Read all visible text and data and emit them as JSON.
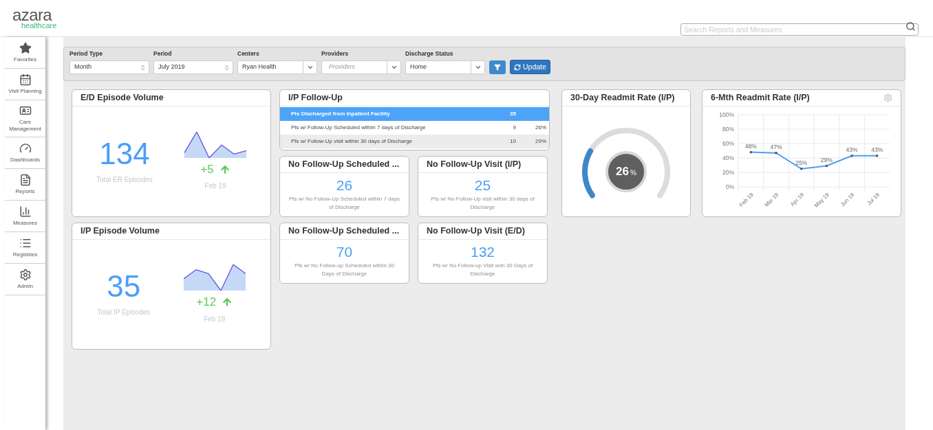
{
  "logo": {
    "name": "azara",
    "tagline": "healthcare"
  },
  "search": {
    "placeholder": "Search Reports and Measures"
  },
  "sidebar": {
    "items": [
      {
        "label": "Favorites",
        "kind": "star"
      },
      {
        "label": "Visit Planning",
        "kind": "calendar"
      },
      {
        "label": "Care Management",
        "kind": "card"
      },
      {
        "label": "Dashboards",
        "kind": "gauge"
      },
      {
        "label": "Reports",
        "kind": "report"
      },
      {
        "label": "Measures",
        "kind": "bars"
      },
      {
        "label": "Registries",
        "kind": "list"
      },
      {
        "label": "Admin",
        "kind": "gear"
      }
    ]
  },
  "filters": [
    {
      "label": "Period Type",
      "value": "Month",
      "kind": "select"
    },
    {
      "label": "Period",
      "value": "July 2019",
      "kind": "select"
    },
    {
      "label": "Centers",
      "value": "Ryan Health",
      "kind": "combo"
    },
    {
      "label": "Providers",
      "placeholder": "Providers",
      "kind": "combo"
    },
    {
      "label": "Discharge Status",
      "value": "Home",
      "kind": "combo"
    }
  ],
  "update_button": "Update",
  "ed_volume": {
    "title": "E/D Episode Volume",
    "value": "134",
    "caption": "Total ER Episodes",
    "change": "+5",
    "period": "Feb 19"
  },
  "ip_volume": {
    "title": "I/P Episode Volume",
    "value": "35",
    "caption": "Total IP Episodes",
    "change": "+12",
    "period": "Feb 19"
  },
  "ip_follow_up": {
    "title": "I/P Follow-Up",
    "rows": [
      {
        "label": "Pts Discharged from Inpatient Facility",
        "count": "35",
        "selected": true
      },
      {
        "label": "Pts w/ Follow-Up Scheduled within 7 days of Discharge",
        "count": "9",
        "percent": "26%",
        "selected": false
      },
      {
        "label": "Pts w/ Follow-Up visit within 30 days of Discharge",
        "count": "10",
        "percent": "29%",
        "selected": false
      }
    ]
  },
  "stat_cards": [
    {
      "title": "No Follow-Up Scheduled ...",
      "value": "26",
      "caption": "Pts w/ No Follow-Up Scheduled within 7 days of Discharge"
    },
    {
      "title": "No Follow-Up Visit (I/P)",
      "value": "25",
      "caption": "Pts w/ No Follow-Up visit within 30 days of Discharge"
    },
    {
      "title": "No Follow-Up Scheduled ...",
      "value": "70",
      "caption": "Pts w/ No Follow-up Scheduled within 30 Days of Discharge"
    },
    {
      "title": "No Follow-Up Visit (E/D)",
      "value": "132",
      "caption": "Pts w/ No Follow-up Visit w/in 30 Days of Discharge"
    }
  ],
  "readmit_30": {
    "title": "30-Day Readmit Rate (I/P)",
    "value": "26",
    "unit": "%"
  },
  "readmit_6m": {
    "title": "6-Mth Readmit Rate (I/P)",
    "chart_data": {
      "type": "line",
      "categories": [
        "Feb 19",
        "Mar 19",
        "Apr 19",
        "May 19",
        "Jun 19",
        "Jul 19"
      ],
      "series": [
        {
          "color": "#4a9ff5",
          "values": [
            48,
            47,
            25,
            29,
            43,
            43
          ]
        }
      ],
      "ylim": [
        0,
        100
      ],
      "grid": true,
      "yticks": [
        {
          "value": 0,
          "label": "0%"
        },
        {
          "value": 20,
          "label": "20%"
        },
        {
          "value": 40,
          "label": "40%"
        },
        {
          "value": 60,
          "label": "60%"
        },
        {
          "value": 80,
          "label": "80%"
        },
        {
          "value": 100,
          "label": "100%"
        }
      ],
      "value_labels": [
        "48%",
        "47%",
        "25%",
        "29%",
        "43%",
        "43%"
      ]
    }
  }
}
